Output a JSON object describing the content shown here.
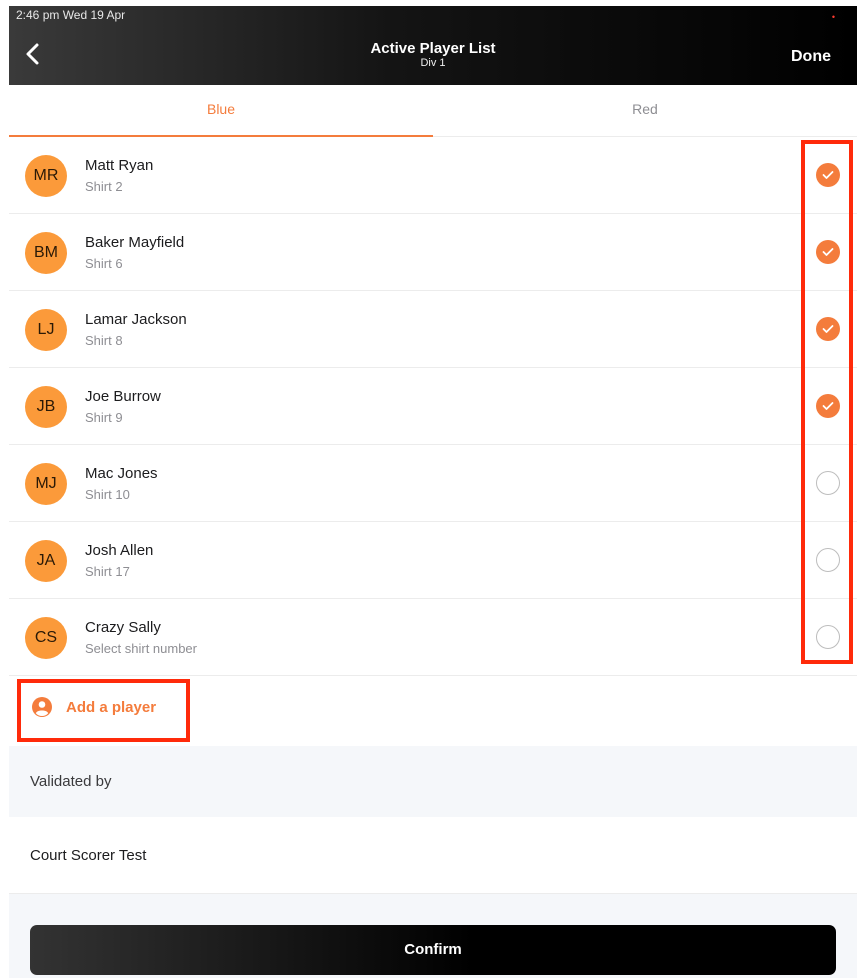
{
  "status_bar": {
    "time_date": "2:46 pm   Wed 19 Apr",
    "indicator": "•"
  },
  "header": {
    "title": "Active Player List",
    "subtitle": "Div 1",
    "done_label": "Done",
    "back_icon": "chevron-left-icon"
  },
  "tabs": [
    {
      "label": "Blue",
      "active": true
    },
    {
      "label": "Red",
      "active": false
    }
  ],
  "players": [
    {
      "initials": "MR",
      "name": "Matt Ryan",
      "shirt": "Shirt 2",
      "selected": true
    },
    {
      "initials": "BM",
      "name": "Baker Mayfield",
      "shirt": "Shirt 6",
      "selected": true
    },
    {
      "initials": "LJ",
      "name": "Lamar Jackson",
      "shirt": "Shirt 8",
      "selected": true
    },
    {
      "initials": "JB",
      "name": "Joe Burrow",
      "shirt": "Shirt 9",
      "selected": true
    },
    {
      "initials": "MJ",
      "name": "Mac Jones",
      "shirt": "Shirt 10",
      "selected": false
    },
    {
      "initials": "JA",
      "name": "Josh Allen",
      "shirt": "Shirt 17",
      "selected": false
    },
    {
      "initials": "CS",
      "name": "Crazy Sally",
      "shirt": "Select shirt number",
      "selected": false
    }
  ],
  "add_player": {
    "label": "Add a player",
    "icon": "user-circle-icon"
  },
  "validated": {
    "section_title": "Validated by",
    "scorer_name": "Court Scorer Test"
  },
  "confirm_label": "Confirm",
  "colors": {
    "accent": "#f47c3c",
    "avatar": "#fb9a3a",
    "annotation": "#ff2a0a"
  }
}
